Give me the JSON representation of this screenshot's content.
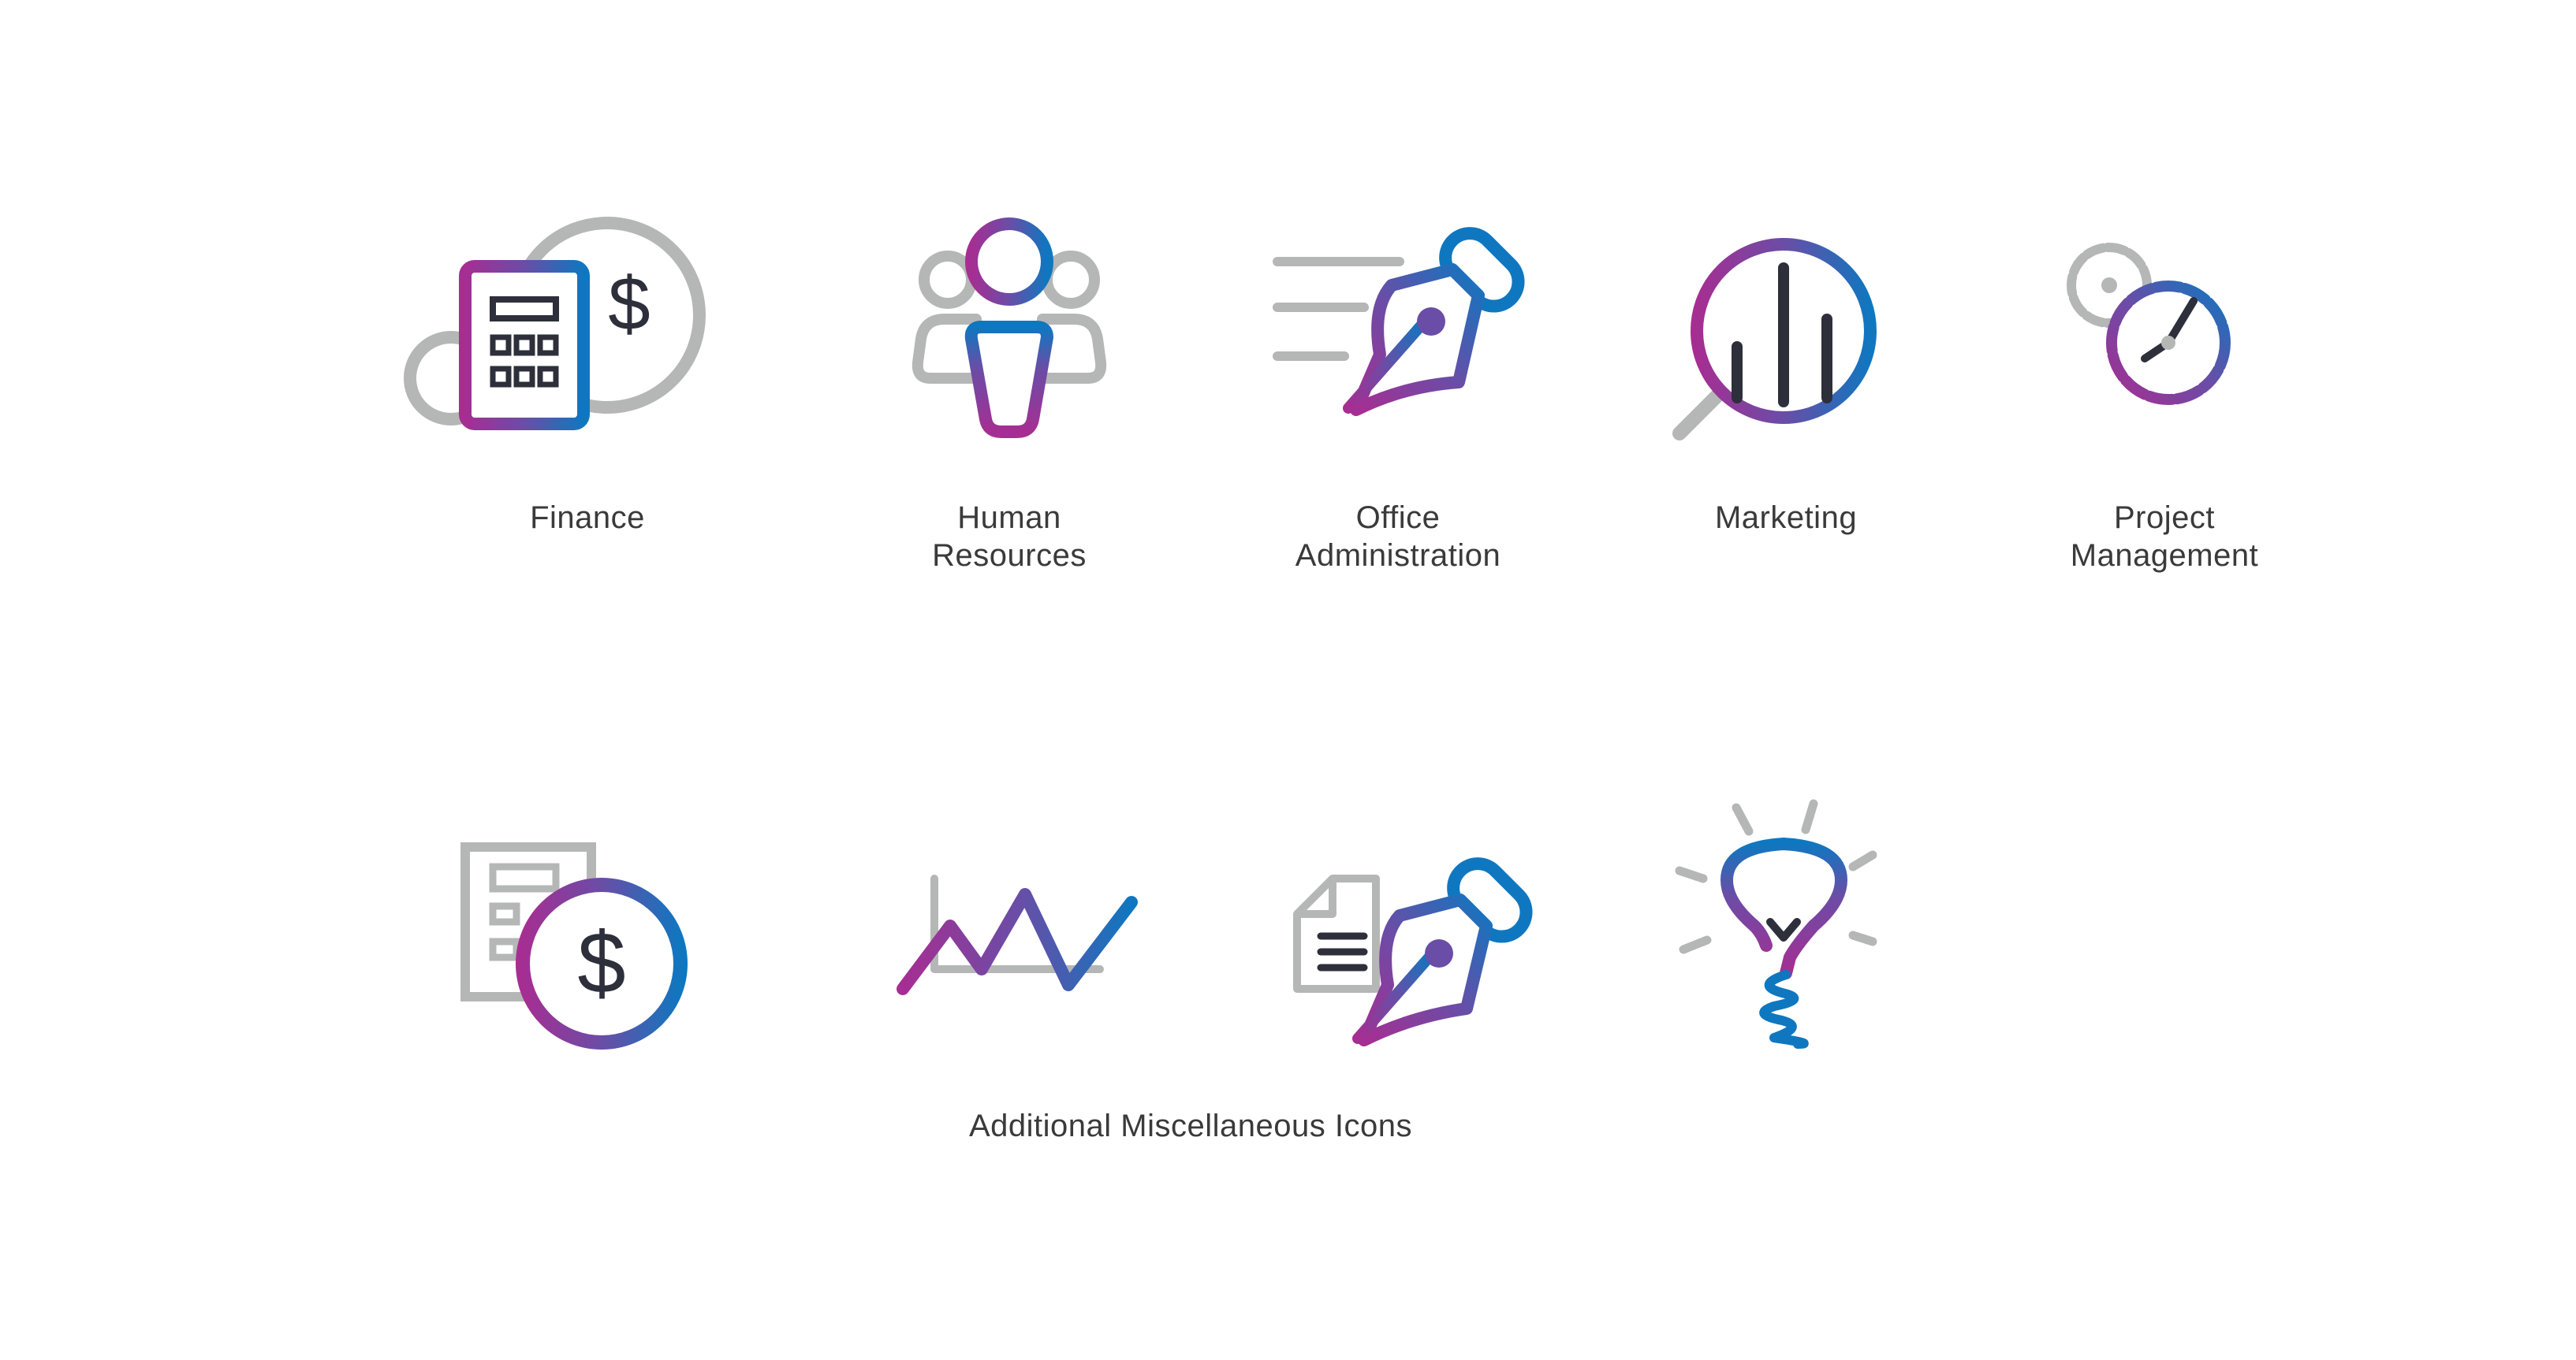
{
  "colors": {
    "gradient_start": "#a62e92",
    "gradient_mid": "#6a4da6",
    "gradient_end": "#0f77c0",
    "gray": "#b5b7b7",
    "dark": "#2d2f3a",
    "label": "#3a3a3a",
    "background": "#ffffff"
  },
  "categories": [
    {
      "icon": "finance-icon",
      "label": "Finance"
    },
    {
      "icon": "human-resources-icon",
      "label": "Human\nResources"
    },
    {
      "icon": "office-administration-icon",
      "label": "Office\nAdministration"
    },
    {
      "icon": "marketing-icon",
      "label": "Marketing"
    },
    {
      "icon": "project-management-icon",
      "label": "Project\nManagement"
    }
  ],
  "misc": {
    "title": "Additional Miscellaneous Icons",
    "icons": [
      "invoice-dollar-icon",
      "line-chart-icon",
      "document-pen-icon",
      "lightbulb-icon"
    ],
    "dollar_symbol": "$"
  },
  "finance": {
    "dollar_symbol": "$"
  }
}
